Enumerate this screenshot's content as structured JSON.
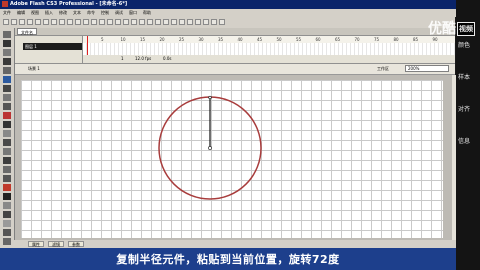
{
  "window": {
    "title": "Adobe Flash CS3 Professional - [未命名-6*]"
  },
  "menu": [
    "文件",
    "编辑",
    "视图",
    "插入",
    "修改",
    "文本",
    "命令",
    "控制",
    "调试",
    "窗口",
    "帮助"
  ],
  "doc_tabs": [
    "文件名"
  ],
  "timeline": {
    "layer_name": "图层 1",
    "frame_numbers": [
      "5",
      "10",
      "15",
      "20",
      "25",
      "30",
      "35",
      "40",
      "45",
      "50",
      "55",
      "60",
      "65",
      "70",
      "75",
      "80",
      "85",
      "90"
    ],
    "current_frame": "1",
    "fps": "12.0 fps",
    "elapsed": "0.0s"
  },
  "editbar": {
    "scene": "场景 1",
    "workspace_label": "工作区",
    "zoom_value": "200%"
  },
  "bottom_tabs": [
    "属性",
    "滤镜",
    "参数"
  ],
  "caption": "复制半径元件，粘贴到当前位置，旋转72度",
  "watermark": {
    "text": "优酷",
    "badge": "视频"
  },
  "right_panel": [
    "颜色",
    "样本",
    "对齐",
    "信息"
  ],
  "colors": {
    "circle_stroke": "#a83c3c",
    "caption_band": "#1d3f8c",
    "titlebar": "#0a246a"
  }
}
